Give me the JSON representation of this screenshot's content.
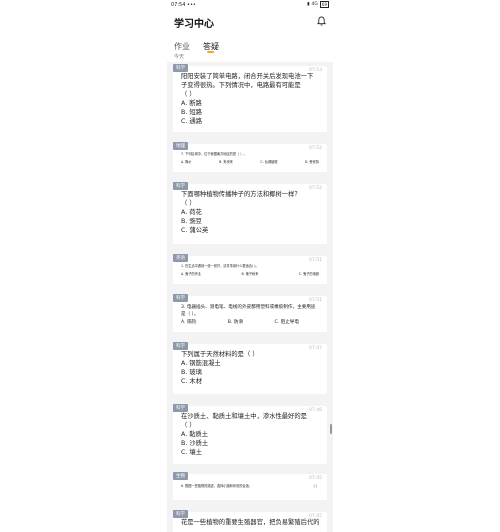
{
  "status": {
    "time": "07:54",
    "dots": "•••",
    "net": "4G",
    "battery": "69"
  },
  "header": {
    "title": "学习中心"
  },
  "tabs": [
    {
      "label": "作业"
    },
    {
      "label": "答疑"
    }
  ],
  "section": {
    "today": "今天"
  },
  "cards": [
    {
      "tag": "科学",
      "time": "07:53",
      "question": "阳阳安装了简单电路，闭合开关后发现电池一下子变得很热。下列情况中，电路最有可能是",
      "blank": "（      ）",
      "options": [
        "A. 断路",
        "B. 短路",
        "C. 通路"
      ]
    },
    {
      "tag": "地理",
      "time": "07:52",
      "question": "7. 下列区域中，位于我国南方地区的是（  ）。",
      "options": [
        "A. 降价",
        "B. 夹块来",
        "C. 台湖被贼",
        "D. 旁安特"
      ]
    },
    {
      "tag": "科学",
      "time": "07:52",
      "question": "下面哪种植物传播种子的方法和椰树一样？",
      "blank": "（      ）",
      "options": [
        "A. 荷花",
        "B. 豌豆",
        "C. 蒲公英"
      ]
    },
    {
      "tag": "英语",
      "time": "07:51",
      "question": "1. 在生活中遇到一张一张开，这件事用什么更适合(  )。",
      "options": [
        "A. 鬼子的作业",
        "B. 鬼子树来",
        "C. 鬼子的电频"
      ]
    },
    {
      "tag": "科学",
      "time": "07:51",
      "question": "3. 电器插头、测电笔、电线的外皮都用塑料或橡胶制作，主要用途是（      ）。",
      "options": [
        "A. 隔热",
        "B. 防滑",
        "C. 阻止导电"
      ]
    },
    {
      "tag": "科学",
      "time": "07:47",
      "question": "下列属于天然材料的是（      ）",
      "options": [
        "A. 钢筋混凝土",
        "B. 玻璃",
        "C. 木材"
      ]
    },
    {
      "tag": "科学",
      "time": "07:46",
      "question": "在沙质土、黏质土和壤土中，渗水性最好的是",
      "blank": "（      ）",
      "options": [
        "A. 黏质土",
        "B. 沙质土",
        "C. 壤土"
      ]
    },
    {
      "tag": "生物",
      "time": "07:45",
      "question": "6. 根据一些植物的描述，选择小题和你说的合适。",
      "options": [
        "（  ）"
      ]
    },
    {
      "tag": "科学",
      "time": "07:45",
      "question": "花是一些植物的重要生殖器官，把负易繁殖后代的"
    }
  ]
}
